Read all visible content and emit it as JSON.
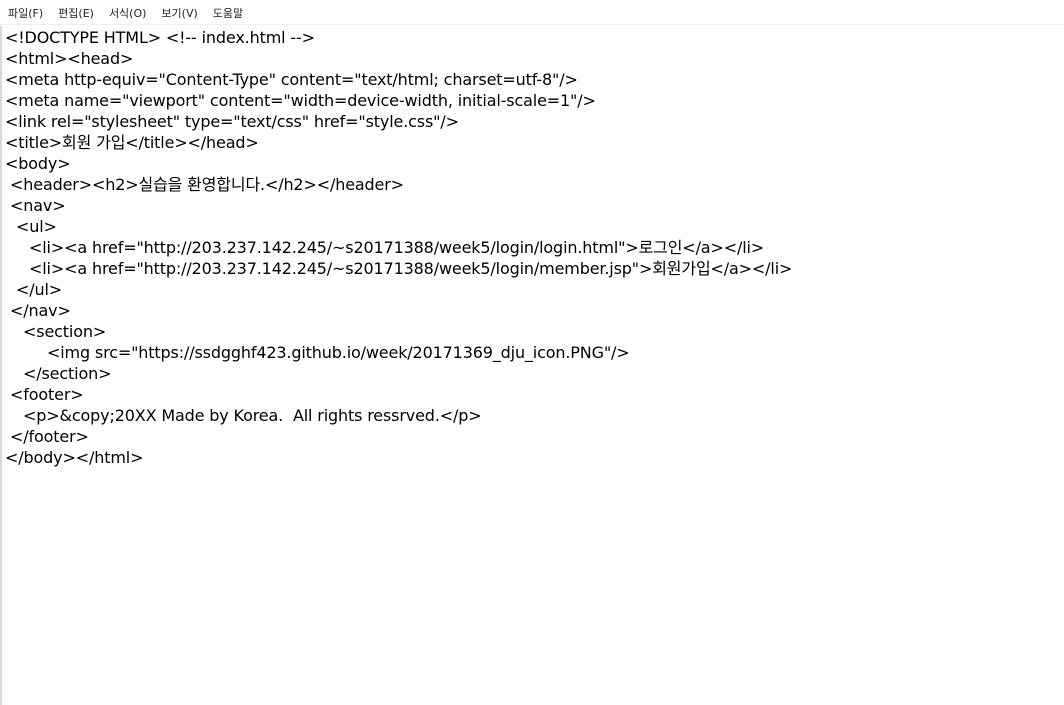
{
  "menu": {
    "file": "파일(F)",
    "edit": "편집(E)",
    "format": "서식(O)",
    "view": "보기(V)",
    "help": "도움말"
  },
  "document": {
    "lines": [
      "<!DOCTYPE HTML> <!-- index.html -->",
      "<html><head>",
      "<meta http-equiv=\"Content-Type\" content=\"text/html; charset=utf-8\"/>",
      "<meta name=\"viewport\" content=\"width=device-width, initial-scale=1\"/>",
      "<link rel=\"stylesheet\" type=\"text/css\" href=\"style.css\"/>",
      "<title>회원 가입</title></head>",
      "<body>",
      "<header><h2>실습을 환영합니다.</h2></header>",
      "<nav>",
      "<ul>",
      "<li><a href=\"http://203.237.142.245/~s20171388/week5/login/login.html\">로그인</a></li>",
      "<li><a href=\"http://203.237.142.245/~s20171388/week5/login/member.jsp\">회원가입</a></li>",
      "</ul>",
      "</nav>",
      "<section>",
      "<img src=\"https://ssdgghf423.github.io/week/20171369_dju_icon.PNG\"/>",
      "</section>",
      "<footer>",
      "<p>&copy;20XX Made by Korea.  All rights ressrved.</p>",
      "</footer>",
      "</body></html>"
    ]
  }
}
